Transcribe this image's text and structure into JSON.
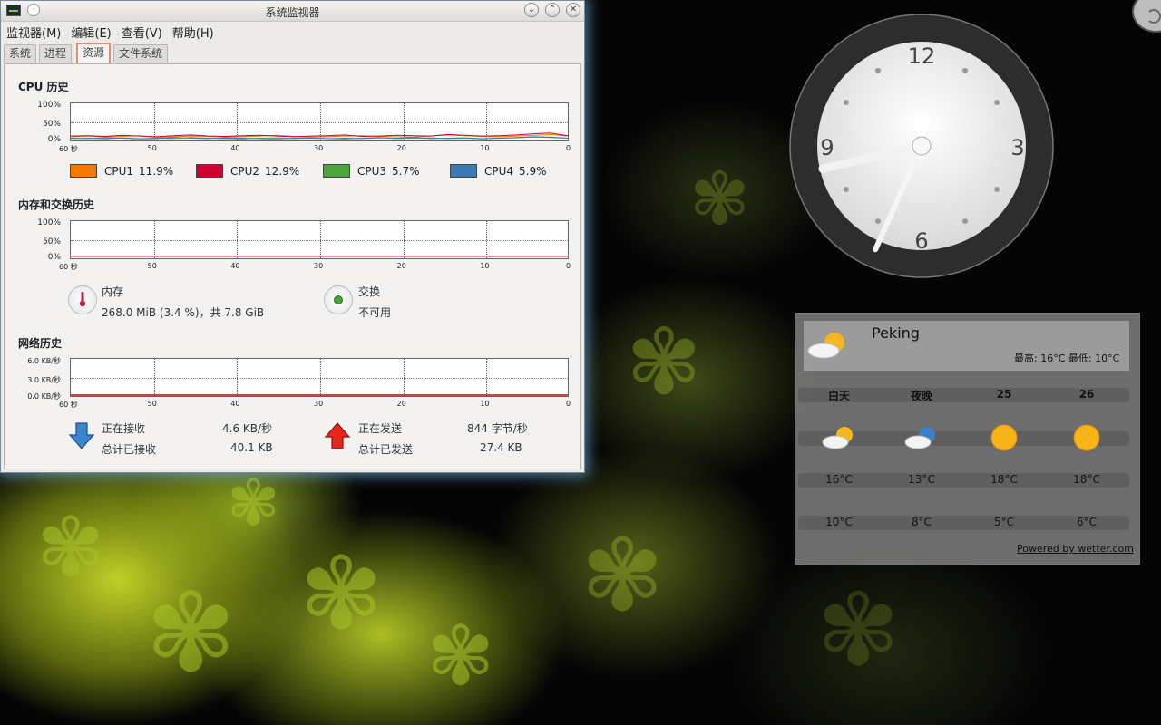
{
  "window": {
    "title": "系统监视器",
    "pin_glyph": "·",
    "buttons": {
      "minimize": "⌄",
      "maximize": "⌃",
      "close": "✕"
    }
  },
  "menubar": [
    "监视器(M)",
    "编辑(E)",
    "查看(V)",
    "帮助(H)"
  ],
  "tabs": [
    {
      "label": "系统",
      "active": false
    },
    {
      "label": "进程",
      "active": false
    },
    {
      "label": "资源",
      "active": true
    },
    {
      "label": "文件系统",
      "active": false
    }
  ],
  "cpu": {
    "title": "CPU 历史",
    "y_ticks": [
      "100%",
      "50%",
      "0%"
    ],
    "x_ticks": [
      "60 秒",
      "50",
      "40",
      "30",
      "20",
      "10",
      "0"
    ],
    "legend": [
      {
        "name": "CPU1",
        "value": "11.9%",
        "color": "#f57900"
      },
      {
        "name": "CPU2",
        "value": "12.9%",
        "color": "#cc0033"
      },
      {
        "name": "CPU3",
        "value": "5.7%",
        "color": "#4ea43c"
      },
      {
        "name": "CPU4",
        "value": "5.9%",
        "color": "#3a78b6"
      }
    ],
    "series": {
      "CPU1": [
        10,
        12,
        9,
        11,
        13,
        8,
        10,
        12,
        11,
        9,
        10,
        12,
        14,
        11,
        9,
        10,
        12,
        13,
        11,
        10,
        9,
        12,
        15,
        13,
        11,
        10,
        12,
        14,
        16,
        12
      ],
      "CPU2": [
        12,
        13,
        11,
        14,
        12,
        10,
        13,
        15,
        12,
        11,
        13,
        14,
        12,
        10,
        12,
        13,
        15,
        11,
        12,
        14,
        13,
        12,
        16,
        14,
        12,
        13,
        15,
        18,
        20,
        13
      ],
      "CPU3": [
        5,
        6,
        4,
        7,
        5,
        6,
        5,
        8,
        6,
        5,
        4,
        6,
        7,
        5,
        6,
        5,
        4,
        6,
        8,
        5,
        6,
        7,
        5,
        6,
        4,
        6,
        7,
        9,
        8,
        6
      ],
      "CPU4": [
        6,
        5,
        7,
        6,
        4,
        5,
        8,
        6,
        5,
        7,
        6,
        5,
        4,
        6,
        7,
        5,
        6,
        5,
        7,
        6,
        8,
        5,
        6,
        7,
        5,
        6,
        8,
        10,
        9,
        6
      ]
    }
  },
  "memory": {
    "title": "内存和交换历史",
    "y_ticks": [
      "100%",
      "50%",
      "0%"
    ],
    "x_ticks": [
      "60 秒",
      "50",
      "40",
      "30",
      "20",
      "10",
      "0"
    ],
    "mem_label": "内存",
    "mem_value": "268.0 MiB (3.4 %)，共 7.8 GiB",
    "mem_percent": 3.4,
    "swap_label": "交换",
    "swap_value": "不可用",
    "mem_color": "#c0204a",
    "swap_color": "#4ea43c"
  },
  "network": {
    "title": "网络历史",
    "y_ticks": [
      "6.0 KB/秒",
      "3.0 KB/秒",
      "0.0 KB/秒"
    ],
    "x_ticks": [
      "60 秒",
      "50",
      "40",
      "30",
      "20",
      "10",
      "0"
    ],
    "receiving_label": "正在接收",
    "receiving_rate": "4.6 KB/秒",
    "total_received_label": "总计已接收",
    "total_received": "40.1 KB",
    "sending_label": "正在发送",
    "sending_rate": "844 字节/秒",
    "total_sent_label": "总计已发送",
    "total_sent": "27.4 KB",
    "receive_color": "#3465a4",
    "send_color": "#cc0000"
  },
  "clock": {
    "numerals": [
      "12",
      "3",
      "6",
      "9"
    ],
    "hour": 8,
    "minute": 34
  },
  "weather": {
    "city": "Peking",
    "hi_lo": "最高: 16°C 最低: 10°C",
    "columns": [
      {
        "label": "白天",
        "icon": "partly-cloudy-sun-icon",
        "high": "16°C",
        "low": "10°C"
      },
      {
        "label": "夜晚",
        "icon": "partly-cloudy-night-icon",
        "high": "13°C",
        "low": "8°C"
      },
      {
        "label": "25",
        "icon": "sun-icon",
        "high": "18°C",
        "low": "5°C"
      },
      {
        "label": "26",
        "icon": "sun-icon",
        "high": "18°C",
        "low": "6°C"
      }
    ],
    "powered_by": "Powered by wetter.com"
  }
}
